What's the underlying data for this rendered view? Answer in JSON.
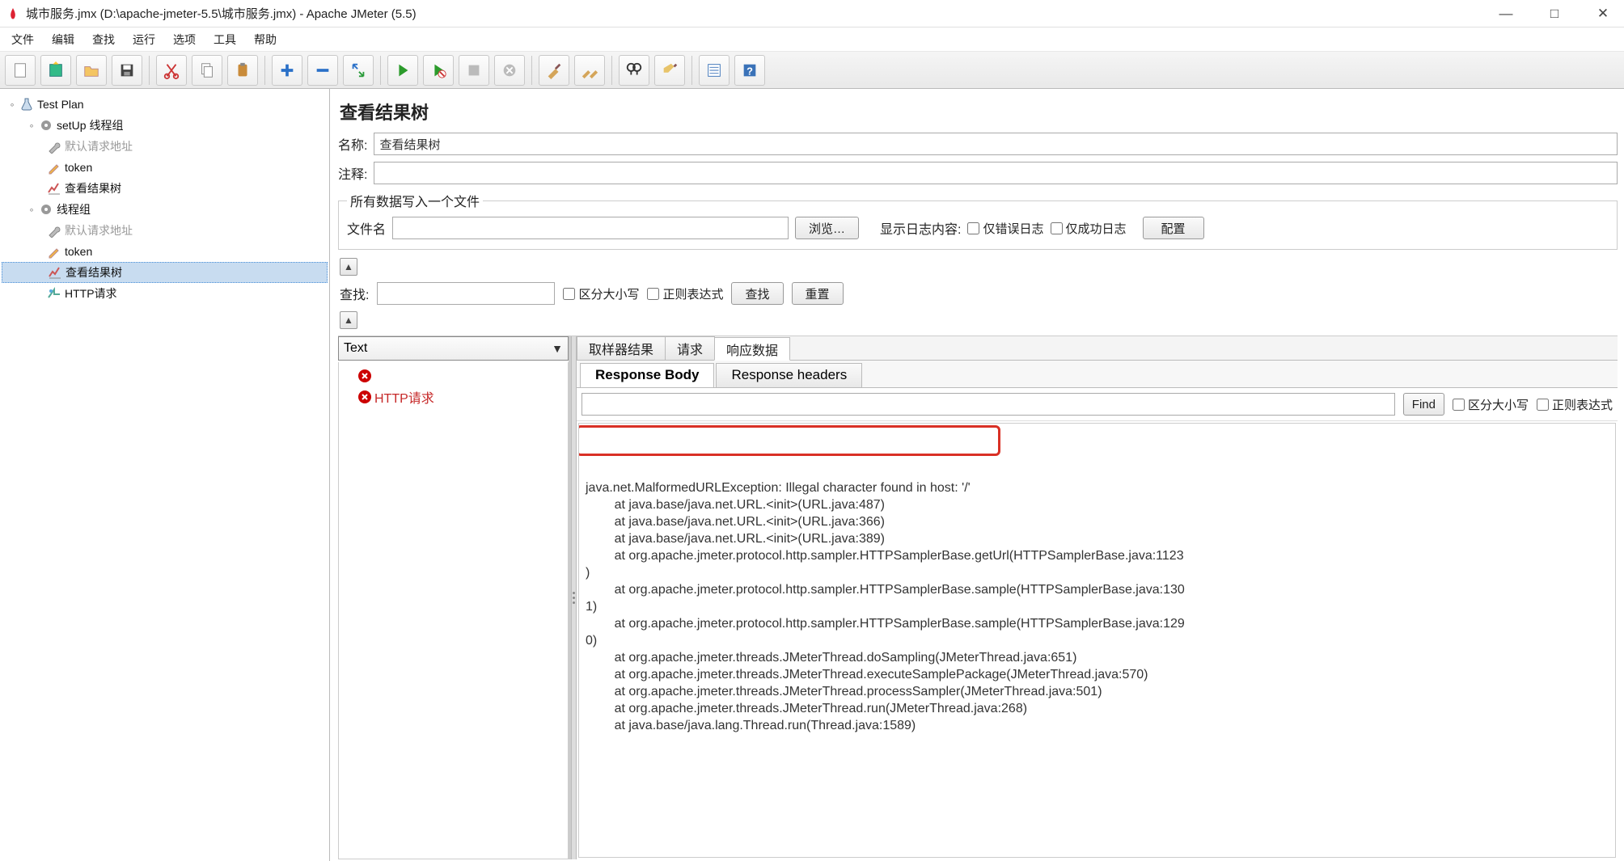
{
  "window": {
    "title": "城市服务.jmx (D:\\apache-jmeter-5.5\\城市服务.jmx) - Apache JMeter (5.5)"
  },
  "menu": [
    "文件",
    "编辑",
    "查找",
    "运行",
    "选项",
    "工具",
    "帮助"
  ],
  "toolbar_icons": [
    "new-file-icon",
    "open-template-icon",
    "open-icon",
    "save-icon",
    "cut-icon",
    "copy-icon",
    "paste-icon",
    "add-icon",
    "remove-icon",
    "reload-icon",
    "play-icon",
    "play-no-timer-icon",
    "stop-icon",
    "shutdown-icon",
    "clear-icon",
    "clear-all-icon",
    "search-icon",
    "broom-icon",
    "function-helper-icon",
    "help-icon"
  ],
  "tree": {
    "root": "Test Plan",
    "nodes": [
      {
        "label": "setUp 线程组",
        "children": [
          {
            "label": "默认请求地址",
            "disabled": true
          },
          {
            "label": "token"
          },
          {
            "label": "查看结果树"
          }
        ]
      },
      {
        "label": "线程组",
        "children": [
          {
            "label": "默认请求地址",
            "disabled": true
          },
          {
            "label": "token"
          },
          {
            "label": "查看结果树",
            "selected": true
          },
          {
            "label": "HTTP请求"
          }
        ]
      }
    ]
  },
  "editor": {
    "title": "查看结果树",
    "name_label": "名称:",
    "name_value": "查看结果树",
    "comment_label": "注释:",
    "comment_value": "",
    "file_group_legend": "所有数据写入一个文件",
    "filename_label": "文件名",
    "filename_value": "",
    "browse_btn": "浏览…",
    "log_label": "显示日志内容:",
    "errors_only": "仅错误日志",
    "success_only": "仅成功日志",
    "configure_btn": "配置",
    "search_label": "查找:",
    "search_value": "",
    "case_sensitive": "区分大小写",
    "regex": "正则表达式",
    "search_btn": "查找",
    "reset_btn": "重置"
  },
  "results": {
    "renderer": "Text",
    "items": [
      {
        "label": ""
      },
      {
        "label": "HTTP请求"
      }
    ]
  },
  "detail": {
    "tabs": [
      "取样器结果",
      "请求",
      "响应数据"
    ],
    "active_tab": 2,
    "sub_tabs": [
      "Response Body",
      "Response headers"
    ],
    "active_sub_tab": 0,
    "find_btn": "Find",
    "find_case": "区分大小写",
    "find_regex": "正则表达式",
    "body_lines": [
      "java.net.MalformedURLException: Illegal character found in host: '/'",
      "\tat java.base/java.net.URL.<init>(URL.java:487)",
      "\tat java.base/java.net.URL.<init>(URL.java:366)",
      "\tat java.base/java.net.URL.<init>(URL.java:389)",
      "\tat org.apache.jmeter.protocol.http.sampler.HTTPSamplerBase.getUrl(HTTPSamplerBase.java:1123",
      ")",
      "\tat org.apache.jmeter.protocol.http.sampler.HTTPSamplerBase.sample(HTTPSamplerBase.java:130",
      "1)",
      "\tat org.apache.jmeter.protocol.http.sampler.HTTPSamplerBase.sample(HTTPSamplerBase.java:129",
      "0)",
      "\tat org.apache.jmeter.threads.JMeterThread.doSampling(JMeterThread.java:651)",
      "\tat org.apache.jmeter.threads.JMeterThread.executeSamplePackage(JMeterThread.java:570)",
      "\tat org.apache.jmeter.threads.JMeterThread.processSampler(JMeterThread.java:501)",
      "\tat org.apache.jmeter.threads.JMeterThread.run(JMeterThread.java:268)",
      "\tat java.base/java.lang.Thread.run(Thread.java:1589)"
    ]
  }
}
